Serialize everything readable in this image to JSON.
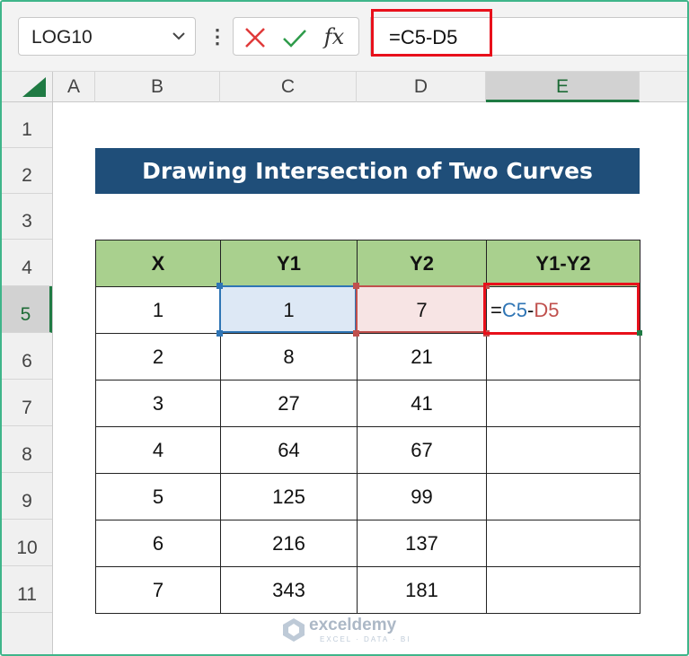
{
  "formula_bar": {
    "name_box": "LOG10",
    "formula": "=C5-D5"
  },
  "columns": [
    "A",
    "B",
    "C",
    "D",
    "E"
  ],
  "active_column": "E",
  "rows": [
    "1",
    "2",
    "3",
    "4",
    "5",
    "6",
    "7",
    "8",
    "9",
    "10",
    "11"
  ],
  "active_row": "5",
  "title": "Drawing Intersection of Two Curves",
  "table": {
    "headers": [
      "X",
      "Y1",
      "Y2",
      "Y1-Y2"
    ],
    "rows": [
      [
        "1",
        "1",
        "7",
        ""
      ],
      [
        "2",
        "8",
        "21",
        ""
      ],
      [
        "3",
        "27",
        "41",
        ""
      ],
      [
        "4",
        "64",
        "67",
        ""
      ],
      [
        "5",
        "125",
        "99",
        ""
      ],
      [
        "6",
        "216",
        "137",
        ""
      ],
      [
        "7",
        "343",
        "181",
        ""
      ]
    ]
  },
  "editing_formula": {
    "eq": "=",
    "ref1": "C5",
    "op": "-",
    "ref2": "D5"
  },
  "watermark": {
    "name": "exceldemy",
    "sub": "EXCEL · DATA · BI"
  },
  "colors": {
    "title_bg": "#1f4e79",
    "header_bg": "#a9d08e",
    "highlight": "#e8101b",
    "ref_c": "#2f75b5",
    "ref_d": "#c0504d"
  }
}
